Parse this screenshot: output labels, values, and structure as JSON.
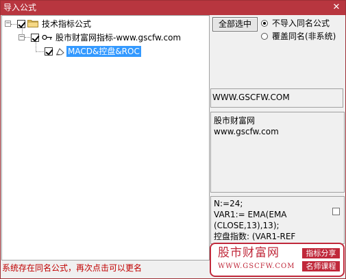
{
  "window": {
    "title": "导入公式",
    "close_glyph": "✕",
    "accent_color": "#b8363f"
  },
  "tree": {
    "root": {
      "label": "技术指标公式",
      "expander": "−",
      "checked": true,
      "icon": "folder-icon"
    },
    "group": {
      "label": "股市财富网指标-www.gscfw.com",
      "expander": "−",
      "checked": true,
      "icon": "key-icon"
    },
    "formula": {
      "label": "MACD&控盘&ROC",
      "checked": true,
      "selected": true,
      "icon": "formula-icon"
    }
  },
  "buttons": {
    "select_all": "全部选中"
  },
  "options": {
    "no_import_same": "不导入同名公式",
    "overwrite_same": "覆盖同名(非系统)",
    "selected": "no_import_same"
  },
  "info": {
    "url": "WWW.GSCFW.COM",
    "desc_line1": "股市财富网",
    "desc_line2": "www.gscfw.com"
  },
  "code": {
    "line1": "N:=24;",
    "line2": "VAR1:= EMA(EMA",
    "line3": "(CLOSE,13),13);",
    "line4": "控盘指数: (VAR1-REF"
  },
  "status": {
    "message": "系统存在同名公式，再次点击可以更名",
    "color": "#c00000"
  },
  "watermark": {
    "name": "股市财富网",
    "url": "WWW.GSCFW.COM",
    "tag1": "指标分享",
    "tag2": "名师课程",
    "color": "#c0283a"
  }
}
